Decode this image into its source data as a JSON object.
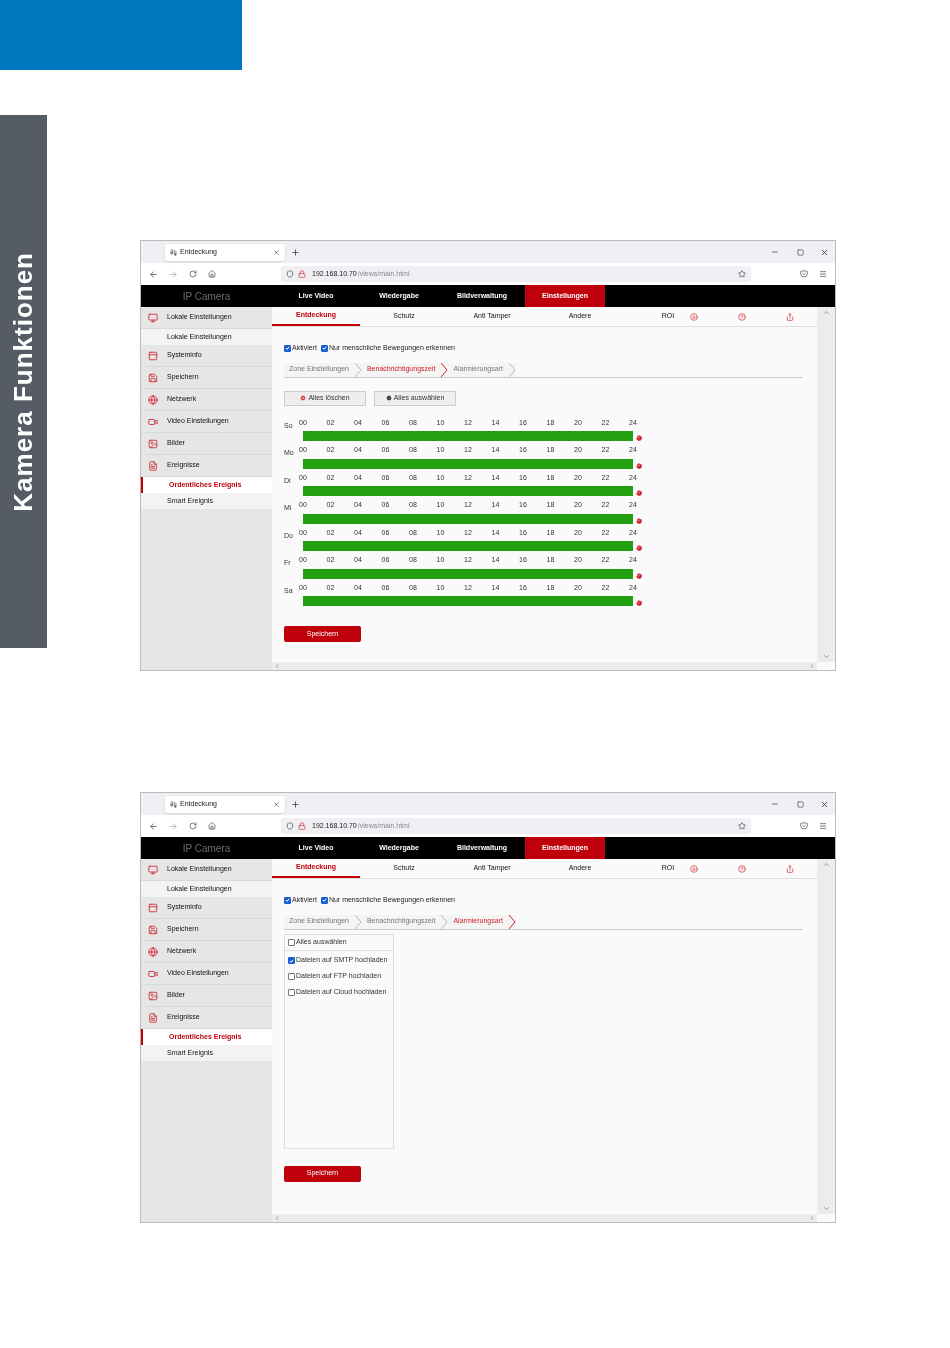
{
  "side_tab": {
    "title": "Kamera Funktionen"
  },
  "screenshots": [
    {
      "browser": {
        "tab_title": "Entdeckung",
        "url_host": "192.168.10.70",
        "url_path": "/views/main.html"
      },
      "brand": "IP Camera",
      "nav": [
        {
          "label": "Live Video",
          "selected": false
        },
        {
          "label": "Wiedergabe",
          "selected": false
        },
        {
          "label": "Bildverwaltung",
          "selected": false
        },
        {
          "label": "Einstellungen",
          "selected": true
        }
      ],
      "sidebar": [
        {
          "label": "Lokale Einstellungen",
          "children": [
            {
              "label": "Lokale Einstellungen",
              "selected": false
            }
          ]
        },
        {
          "label": "Systeminfo"
        },
        {
          "label": "Speichern"
        },
        {
          "label": "Netzwerk"
        },
        {
          "label": "Video Einstellungen"
        },
        {
          "label": "Bilder"
        },
        {
          "label": "Ereignisse",
          "children": [
            {
              "label": "Ordentliches Ereignis",
              "selected": true
            },
            {
              "label": "Smart Ereignis",
              "selected": false
            }
          ]
        }
      ],
      "subtabs": [
        {
          "label": "Entdeckung",
          "selected": true
        },
        {
          "label": "Schutz",
          "selected": false
        },
        {
          "label": "Anti Tamper",
          "selected": false
        },
        {
          "label": "Andere",
          "selected": false
        },
        {
          "label": "ROI",
          "selected": false
        }
      ],
      "checkboxes": [
        {
          "label": "Aktiviert",
          "checked": true
        },
        {
          "label": "Nur menschliche Bewegungen erkennen",
          "checked": true
        }
      ],
      "steps": [
        {
          "label": "Zone Einstellungen",
          "selected": false
        },
        {
          "label": "Benachrichtigungszeit",
          "selected": true
        },
        {
          "label": "Alarmierungsart",
          "selected": false
        }
      ],
      "content": {
        "kind": "schedule",
        "actions": [
          {
            "kind": "clear",
            "label": "Alles löschen"
          },
          {
            "kind": "select_all",
            "label": "Alles auswählen"
          }
        ],
        "days": [
          {
            "label": "So",
            "hours": [
              "00",
              "02",
              "04",
              "06",
              "08",
              "10",
              "12",
              "14",
              "16",
              "18",
              "20",
              "22",
              "24"
            ]
          },
          {
            "label": "Mo",
            "hours": [
              "00",
              "02",
              "04",
              "06",
              "08",
              "10",
              "12",
              "14",
              "16",
              "18",
              "20",
              "22",
              "24"
            ]
          },
          {
            "label": "Di",
            "hours": [
              "00",
              "02",
              "04",
              "06",
              "08",
              "10",
              "12",
              "14",
              "16",
              "18",
              "20",
              "22",
              "24"
            ]
          },
          {
            "label": "Mi",
            "hours": [
              "00",
              "02",
              "04",
              "06",
              "08",
              "10",
              "12",
              "14",
              "16",
              "18",
              "20",
              "22",
              "24"
            ]
          },
          {
            "label": "Do",
            "hours": [
              "00",
              "02",
              "04",
              "06",
              "08",
              "10",
              "12",
              "14",
              "16",
              "18",
              "20",
              "22",
              "24"
            ]
          },
          {
            "label": "Fr",
            "hours": [
              "00",
              "02",
              "04",
              "06",
              "08",
              "10",
              "12",
              "14",
              "16",
              "18",
              "20",
              "22",
              "24"
            ]
          },
          {
            "label": "Sa",
            "hours": [
              "00",
              "02",
              "04",
              "06",
              "08",
              "10",
              "12",
              "14",
              "16",
              "18",
              "20",
              "22",
              "24"
            ]
          }
        ]
      },
      "save_button": "Speichern"
    },
    {
      "browser": {
        "tab_title": "Entdeckung",
        "url_host": "192.168.10.70",
        "url_path": "/views/main.html"
      },
      "brand": "IP Camera",
      "nav": [
        {
          "label": "Live Video",
          "selected": false
        },
        {
          "label": "Wiedergabe",
          "selected": false
        },
        {
          "label": "Bildverwaltung",
          "selected": false
        },
        {
          "label": "Einstellungen",
          "selected": true
        }
      ],
      "sidebar": [
        {
          "label": "Lokale Einstellungen",
          "children": [
            {
              "label": "Lokale Einstellungen",
              "selected": false
            }
          ]
        },
        {
          "label": "Systeminfo"
        },
        {
          "label": "Speichern"
        },
        {
          "label": "Netzwerk"
        },
        {
          "label": "Video Einstellungen"
        },
        {
          "label": "Bilder"
        },
        {
          "label": "Ereignisse",
          "children": [
            {
              "label": "Ordentliches Ereignis",
              "selected": true
            },
            {
              "label": "Smart Ereignis",
              "selected": false
            }
          ]
        }
      ],
      "subtabs": [
        {
          "label": "Entdeckung",
          "selected": true
        },
        {
          "label": "Schutz",
          "selected": false
        },
        {
          "label": "Anti Tamper",
          "selected": false
        },
        {
          "label": "Andere",
          "selected": false
        },
        {
          "label": "ROI",
          "selected": false
        }
      ],
      "checkboxes": [
        {
          "label": "Aktiviert",
          "checked": true
        },
        {
          "label": "Nur menschliche Bewegungen erkennen",
          "checked": true
        }
      ],
      "steps": [
        {
          "label": "Zone Einstellungen",
          "selected": false
        },
        {
          "label": "Benachrichtigungszeit",
          "selected": false
        },
        {
          "label": "Alarmierungsart",
          "selected": true
        }
      ],
      "content": {
        "kind": "alarm_type",
        "options": [
          {
            "label": "Alles auswählen",
            "checked": false
          },
          {
            "label": "Dateien auf SMTP hochladen",
            "checked": true
          },
          {
            "label": "Dateien auf FTP hochladen",
            "checked": false
          },
          {
            "label": "Dateien auf Cloud hochladen",
            "checked": false
          }
        ]
      },
      "save_button": "Speichern"
    }
  ]
}
